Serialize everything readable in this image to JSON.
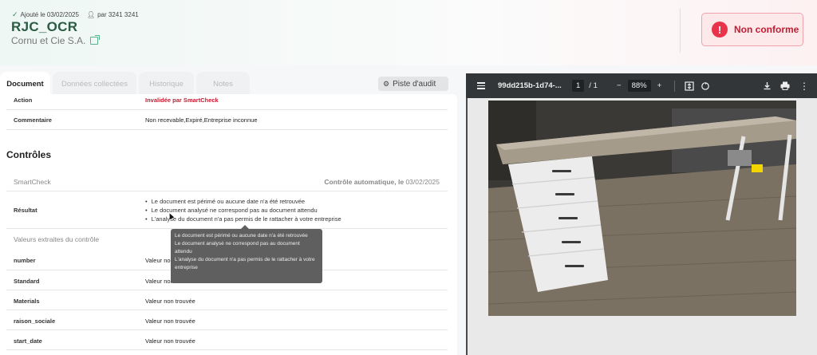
{
  "header": {
    "added": "Ajouté le 03/02/2025",
    "by": "par 3241 3241",
    "title": "RJC_OCR",
    "company": "Cornu et Cie S.A.",
    "status": "Non conforme",
    "status_icon": "!"
  },
  "tabs": [
    "Document",
    "Données collectées",
    "Historique",
    "Notes"
  ],
  "audit_label": "Piste d'audit",
  "rows_top": [
    {
      "key": "Action",
      "value": "Invalidée par SmartCheck"
    },
    {
      "key": "Commentaire",
      "value": "Non recevable,Expiré,Entreprise inconnue"
    }
  ],
  "controls": {
    "title": "Contrôles",
    "smartcheck": "SmartCheck",
    "auto_label": "Contrôle automatique, le",
    "auto_date": "03/02/2025",
    "result_key": "Résultat",
    "results": [
      "Le document est périmé ou aucune date n'a été retrouvée",
      "Le document analysé ne correspond pas au document attendu",
      "L'analyse du document n'a pas permis de le rattacher à votre entreprise"
    ],
    "extracted_title": "Valeurs extraites du contrôle",
    "extracted": [
      {
        "key": "number",
        "value": "Valeur non trouvée"
      },
      {
        "key": "Standard",
        "value": "Valeur non trouvée"
      },
      {
        "key": "Materials",
        "value": "Valeur non trouvée"
      },
      {
        "key": "raison_sociale",
        "value": "Valeur non trouvée"
      },
      {
        "key": "start_date",
        "value": "Valeur non trouvée"
      }
    ]
  },
  "tooltip": [
    "Le document est périmé ou aucune date n'a été retrouvée",
    "Le document analysé ne correspond pas au document attendu",
    "L'analyse du document n'a pas permis de le rattacher à votre entreprise"
  ],
  "pdf": {
    "filename": "99dd215b-1d74-...",
    "page": "1",
    "pages": "/ 1",
    "zoom_out": "−",
    "zoom": "88%",
    "zoom_in": "+"
  },
  "colors": {
    "accent": "#2a5c44",
    "error": "#c21c32",
    "toolbar": "#323639"
  }
}
